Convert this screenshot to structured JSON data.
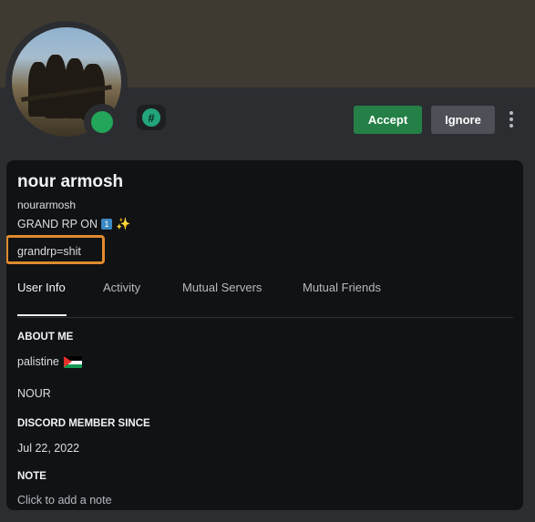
{
  "header": {
    "accept_label": "Accept",
    "ignore_label": "Ignore",
    "badge_symbol": "#",
    "status_color": "#23a55a"
  },
  "profile": {
    "display_name": "nour armosh",
    "username": "nourarmosh",
    "custom_status_text": "GRAND RP ON",
    "custom_status_emoji_1": "1",
    "custom_status_emoji_2": "✨",
    "note_highlight": "grandrp=shit"
  },
  "tabs": [
    {
      "label": "User Info",
      "active": true
    },
    {
      "label": "Activity",
      "active": false
    },
    {
      "label": "Mutual Servers",
      "active": false
    },
    {
      "label": "Mutual Friends",
      "active": false
    }
  ],
  "about": {
    "title": "ABOUT ME",
    "line1": "palistine",
    "line2": "NOUR"
  },
  "member_since": {
    "title": "DISCORD MEMBER SINCE",
    "date": "Jul 22, 2022"
  },
  "note": {
    "title": "NOTE",
    "placeholder": "Click to add a note"
  },
  "colors": {
    "accent_highlight": "#e08a2e",
    "accept_green": "#248046"
  }
}
